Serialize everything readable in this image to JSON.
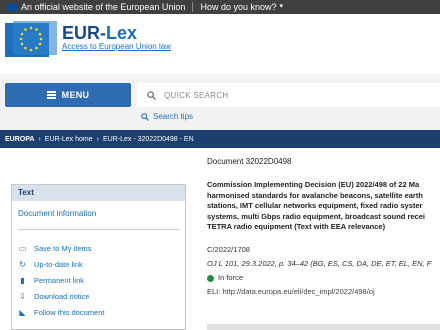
{
  "topbar": {
    "official_text": "An official website of the European Union",
    "how_know": "How do you know?"
  },
  "header": {
    "brand_eur": "EUR-",
    "brand_lex": "Lex",
    "tagline": "Access to European Union law"
  },
  "nav": {
    "menu_label": "MENU",
    "search_placeholder": "QUICK SEARCH",
    "search_tips": "Search tips"
  },
  "breadcrumb": {
    "items": [
      "EUROPA",
      "EUR-Lex home",
      "EUR-Lex - 32022D0498 - EN"
    ]
  },
  "sidebar": {
    "header": "Text",
    "doc_info": "Document information",
    "items": [
      {
        "label": "Save to My items",
        "icon": "save-icon"
      },
      {
        "label": "Up-to-date link",
        "icon": "refresh-icon"
      },
      {
        "label": "Permanent link",
        "icon": "bookmark-icon"
      },
      {
        "label": "Download notice",
        "icon": "download-icon"
      },
      {
        "label": "Follow this document",
        "icon": "rss-icon"
      }
    ]
  },
  "document": {
    "number": "Document 32022D0498",
    "title_lines": [
      "Commission Implementing Decision (EU) 2022/498 of 22 Ma",
      "harmonised standards for avalanche beacons, satellite earth",
      "stations, IMT cellular networks equipment, fixed radio syster",
      "systems, multi Gbps radio equipment, broadcast sound recei",
      "TETRA radio equipment (Text with EEA relevance)"
    ],
    "c_number": "C/2022/1708",
    "oj_ref": "OJ L 101, 29.3.2022, p. 34–42 (BG, ES, CS, DA, DE, ET, EL, EN, F",
    "status": "In force",
    "eli_label": "ELI:",
    "eli_link": "http://data.europa.eu/eli/dec_impl/2022/498/oj"
  },
  "colors": {
    "accent": "#2e6bb0",
    "breadcrumb_bg": "#1b3f6e",
    "topbar_bg": "#404040",
    "in_force": "#2c8a3e"
  }
}
